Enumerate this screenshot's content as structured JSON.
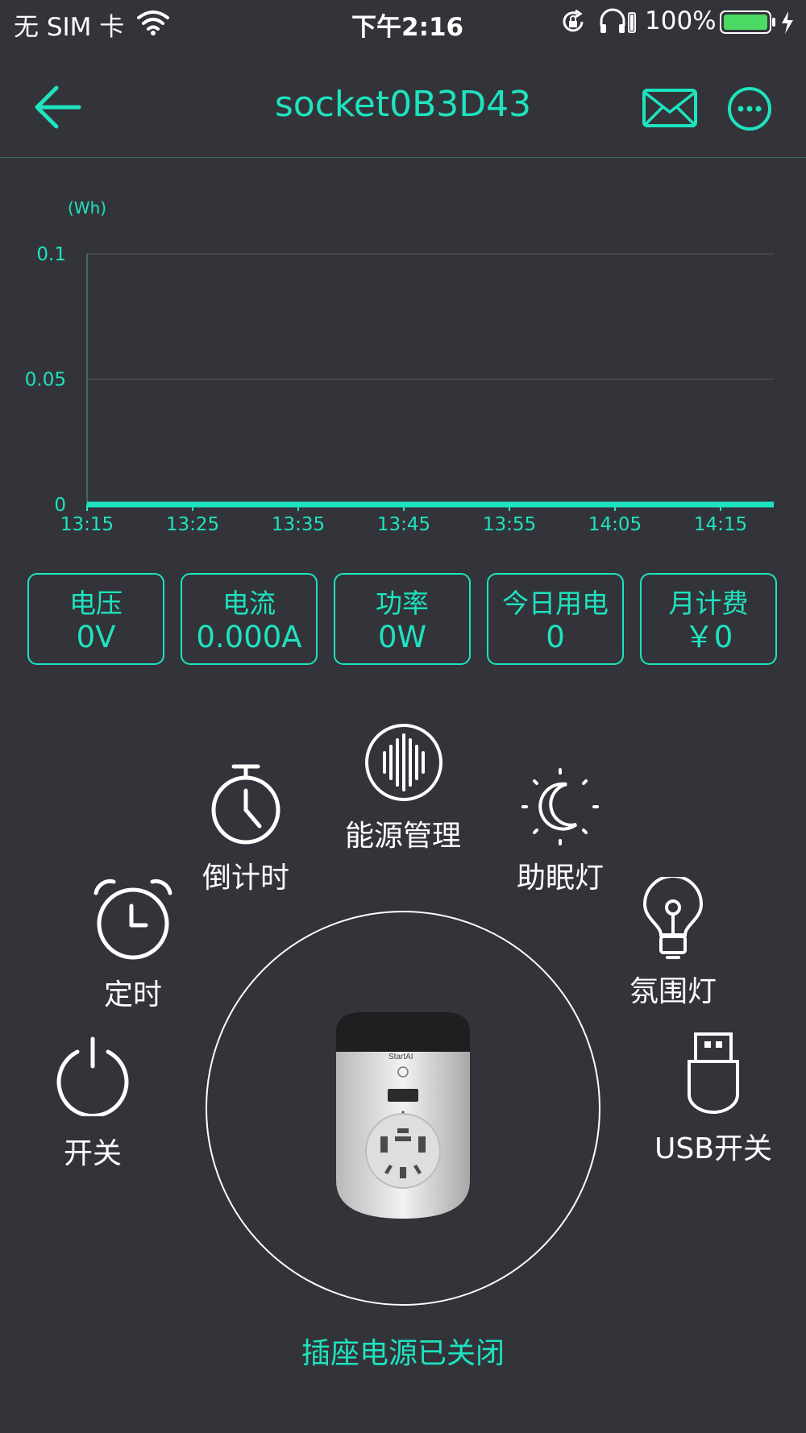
{
  "status_bar": {
    "carrier": "无 SIM 卡",
    "time": "下午2:16",
    "battery": "100%"
  },
  "header": {
    "title": "socket0B3D43"
  },
  "colors": {
    "accent": "#1ee3c0",
    "background": "#333439"
  },
  "icons": {
    "back": "back-arrow-icon",
    "message": "envelope-icon",
    "more": "more-icon"
  },
  "chart_data": {
    "type": "line",
    "unit_label": "(Wh)",
    "y_ticks": [
      "0.1",
      "0.05",
      "0"
    ],
    "ylim": [
      0,
      0.1
    ],
    "x": [
      "13:15",
      "13:25",
      "13:35",
      "13:45",
      "13:55",
      "14:05",
      "14:15"
    ],
    "series": [
      {
        "values": [
          0,
          0,
          0,
          0,
          0,
          0,
          0
        ]
      }
    ],
    "grid": true
  },
  "stats": [
    {
      "label": "电压",
      "value": "0V"
    },
    {
      "label": "电流",
      "value": "0.000A"
    },
    {
      "label": "功率",
      "value": "0W"
    },
    {
      "label": "今日用电",
      "value": "0"
    },
    {
      "label": "月计费",
      "value": "￥0"
    }
  ],
  "features": {
    "energy": "能源管理",
    "countdown": "倒计时",
    "sleep_light": "助眠灯",
    "timer": "定时",
    "ambient_light": "氛围灯",
    "power": "开关",
    "usb": "USB开关"
  },
  "device": {
    "brand": "StartAI",
    "status": "插座电源已关闭"
  }
}
